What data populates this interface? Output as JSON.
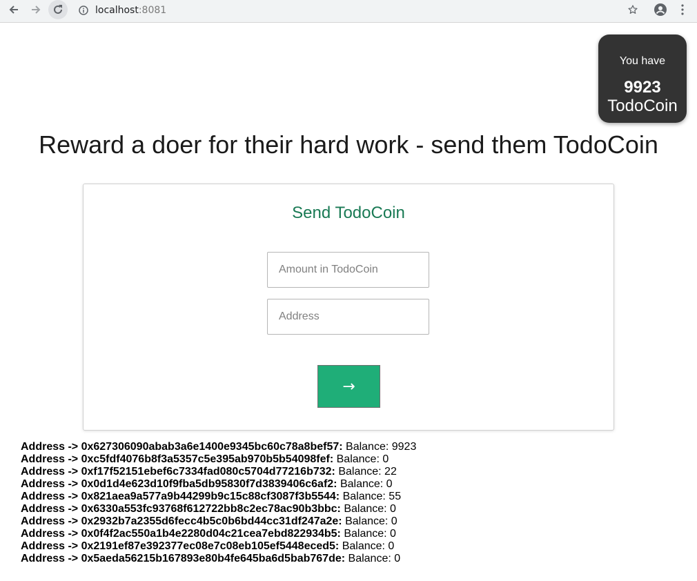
{
  "browser": {
    "url_host": "localhost",
    "url_port": ":8081"
  },
  "balance": {
    "label": "You have",
    "amount": "9923",
    "unit": "TodoCoin"
  },
  "headline": "Reward a doer for their hard work - send them TodoCoin",
  "form": {
    "title": "Send TodoCoin",
    "amount_placeholder": "Amount in TodoCoin",
    "address_placeholder": "Address",
    "submit_label": "→"
  },
  "accounts": [
    {
      "label": "Address -> 0x627306090abab3a6e1400e9345bc60c78a8bef57:",
      "balance": "Balance: 9923"
    },
    {
      "label": "Address -> 0xc5fdf4076b8f3a5357c5e395ab970b5b54098fef:",
      "balance": "Balance: 0"
    },
    {
      "label": "Address -> 0xf17f52151ebef6c7334fad080c5704d77216b732:",
      "balance": "Balance: 22"
    },
    {
      "label": "Address -> 0x0d1d4e623d10f9fba5db95830f7d3839406c6af2:",
      "balance": "Balance: 0"
    },
    {
      "label": "Address -> 0x821aea9a577a9b44299b9c15c88cf3087f3b5544:",
      "balance": "Balance: 55"
    },
    {
      "label": "Address -> 0x6330a553fc93768f612722bb8c2ec78ac90b3bbc:",
      "balance": "Balance: 0"
    },
    {
      "label": "Address -> 0x2932b7a2355d6fecc4b5c0b6bd44cc31df247a2e:",
      "balance": "Balance: 0"
    },
    {
      "label": "Address -> 0x0f4f2ac550a1b4e2280d04c21cea7ebd822934b5:",
      "balance": "Balance: 0"
    },
    {
      "label": "Address -> 0x2191ef87e392377ec08e7c08eb105ef5448eced5:",
      "balance": "Balance: 0"
    },
    {
      "label": "Address -> 0x5aeda56215b167893e80b4fe645ba6d5bab767de:",
      "balance": "Balance: 0"
    }
  ]
}
